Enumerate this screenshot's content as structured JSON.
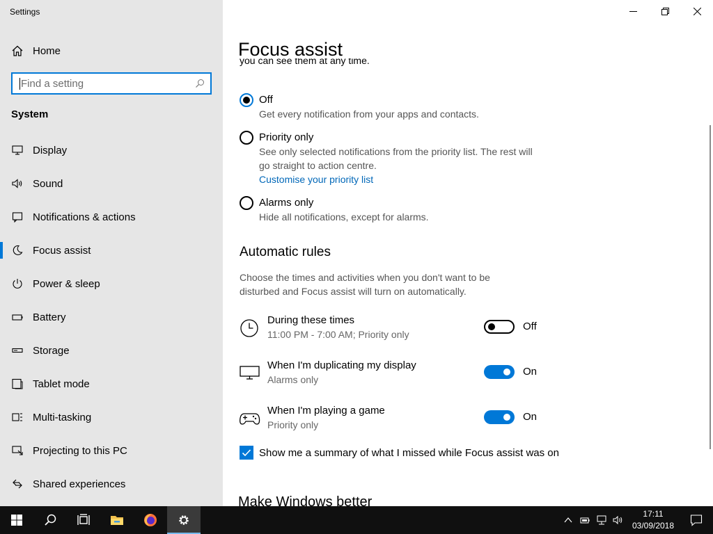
{
  "window": {
    "title": "Settings"
  },
  "sidebar": {
    "home_label": "Home",
    "search_placeholder": "Find a setting",
    "section_label": "System",
    "items": [
      {
        "label": "Display",
        "icon": "monitor-icon"
      },
      {
        "label": "Sound",
        "icon": "speaker-icon"
      },
      {
        "label": "Notifications & actions",
        "icon": "notifications-icon"
      },
      {
        "label": "Focus assist",
        "icon": "moon-icon",
        "active": true
      },
      {
        "label": "Power & sleep",
        "icon": "power-icon"
      },
      {
        "label": "Battery",
        "icon": "battery-icon"
      },
      {
        "label": "Storage",
        "icon": "storage-icon"
      },
      {
        "label": "Tablet mode",
        "icon": "tablet-icon"
      },
      {
        "label": "Multi-tasking",
        "icon": "multitasking-icon"
      },
      {
        "label": "Projecting to this PC",
        "icon": "projecting-icon"
      },
      {
        "label": "Shared experiences",
        "icon": "shared-experiences-icon"
      }
    ]
  },
  "main": {
    "title": "Focus assist",
    "clipped_intro": "you can see them at any time.",
    "options": [
      {
        "label": "Off",
        "description": "Get every notification from your apps and contacts.",
        "checked": true
      },
      {
        "label": "Priority only",
        "description": "See only selected notifications from the priority list. The rest will go straight to action centre.",
        "link": "Customise your priority list",
        "checked": false
      },
      {
        "label": "Alarms only",
        "description": "Hide all notifications, except for alarms.",
        "checked": false
      }
    ],
    "automatic_rules": {
      "heading": "Automatic rules",
      "description": "Choose the times and activities when you don't want to be disturbed and Focus assist will turn on automatically.",
      "rules": [
        {
          "title": "During these times",
          "subtitle": "11:00 PM - 7:00 AM; Priority only",
          "state": "Off",
          "on": false,
          "icon": "clock-icon"
        },
        {
          "title": "When I'm duplicating my display",
          "subtitle": "Alarms only",
          "state": "On",
          "on": true,
          "icon": "monitor-icon"
        },
        {
          "title": "When I'm playing a game",
          "subtitle": "Priority only",
          "state": "On",
          "on": true,
          "icon": "gamepad-icon"
        }
      ]
    },
    "summary_checkbox": {
      "label": "Show me a summary of what I missed while Focus assist was on",
      "checked": true
    },
    "next_heading": "Make Windows better"
  },
  "taskbar": {
    "time": "17:11",
    "date": "03/09/2018"
  },
  "colors": {
    "accent": "#0078d7",
    "link": "#0067b8",
    "sidebar_bg": "#e6e6e6",
    "taskbar_bg": "#101010"
  }
}
